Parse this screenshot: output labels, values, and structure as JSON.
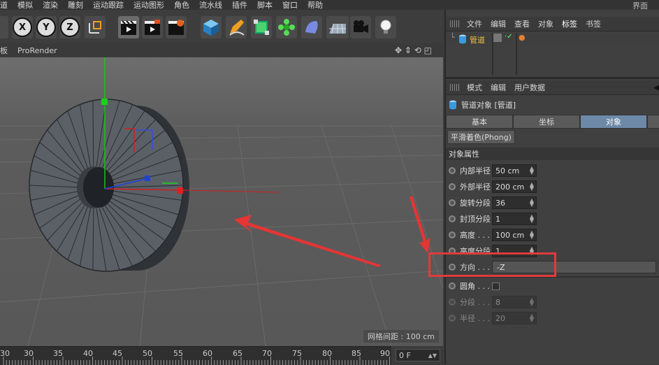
{
  "menubar": {
    "items": [
      "道",
      "模拟",
      "渲染",
      "雕刻",
      "运动跟踪",
      "运动图形",
      "角色",
      "流水线",
      "插件",
      "脚本",
      "窗口",
      "帮助"
    ],
    "right_label": "界面"
  },
  "toolbar": {
    "axis_x": "X",
    "axis_y": "Y",
    "axis_z": "Z"
  },
  "viewport_bar": {
    "tab_prefix": "板",
    "tab_label": "ProRender"
  },
  "viewport": {
    "grid_spacing": "网格间距 : 100 cm"
  },
  "timeline": {
    "ticks": [
      "30",
      "35",
      "40",
      "45",
      "50",
      "55",
      "60",
      "65",
      "70",
      "75",
      "80",
      "85",
      "90"
    ],
    "current_frame": "0 F"
  },
  "object_manager": {
    "menu": [
      "文件",
      "编辑",
      "查看",
      "对象",
      "标签",
      "书签"
    ],
    "active_menu": "标签",
    "object_name": "管道"
  },
  "attributes": {
    "menu": [
      "模式",
      "编辑",
      "用户数据"
    ],
    "title": "管道对象 [管道]",
    "tabs": [
      "基本",
      "坐标",
      "对象"
    ],
    "active_tab": "对象",
    "phong_button": "平滑着色(Phong)",
    "section": "对象属性",
    "rows": [
      {
        "label": "内部半径",
        "value": "50 cm"
      },
      {
        "label": "外部半径",
        "value": "200 cm"
      },
      {
        "label": "旋转分段",
        "value": "36"
      },
      {
        "label": "封顶分段",
        "value": "1"
      },
      {
        "label": "高度 . . .",
        "value": "100 cm"
      },
      {
        "label": "高度分段",
        "value": "1"
      }
    ],
    "direction_label": "方向 . . .",
    "direction_value": "-Z",
    "fillet_label": "圆角 . . .",
    "segments_label": "分段 . . .",
    "segments_value": "8",
    "radius_label": "半径 . . .",
    "radius_value": "20"
  },
  "colors": {
    "accent": "#6d89a8",
    "annotation": "#e23a3a"
  }
}
